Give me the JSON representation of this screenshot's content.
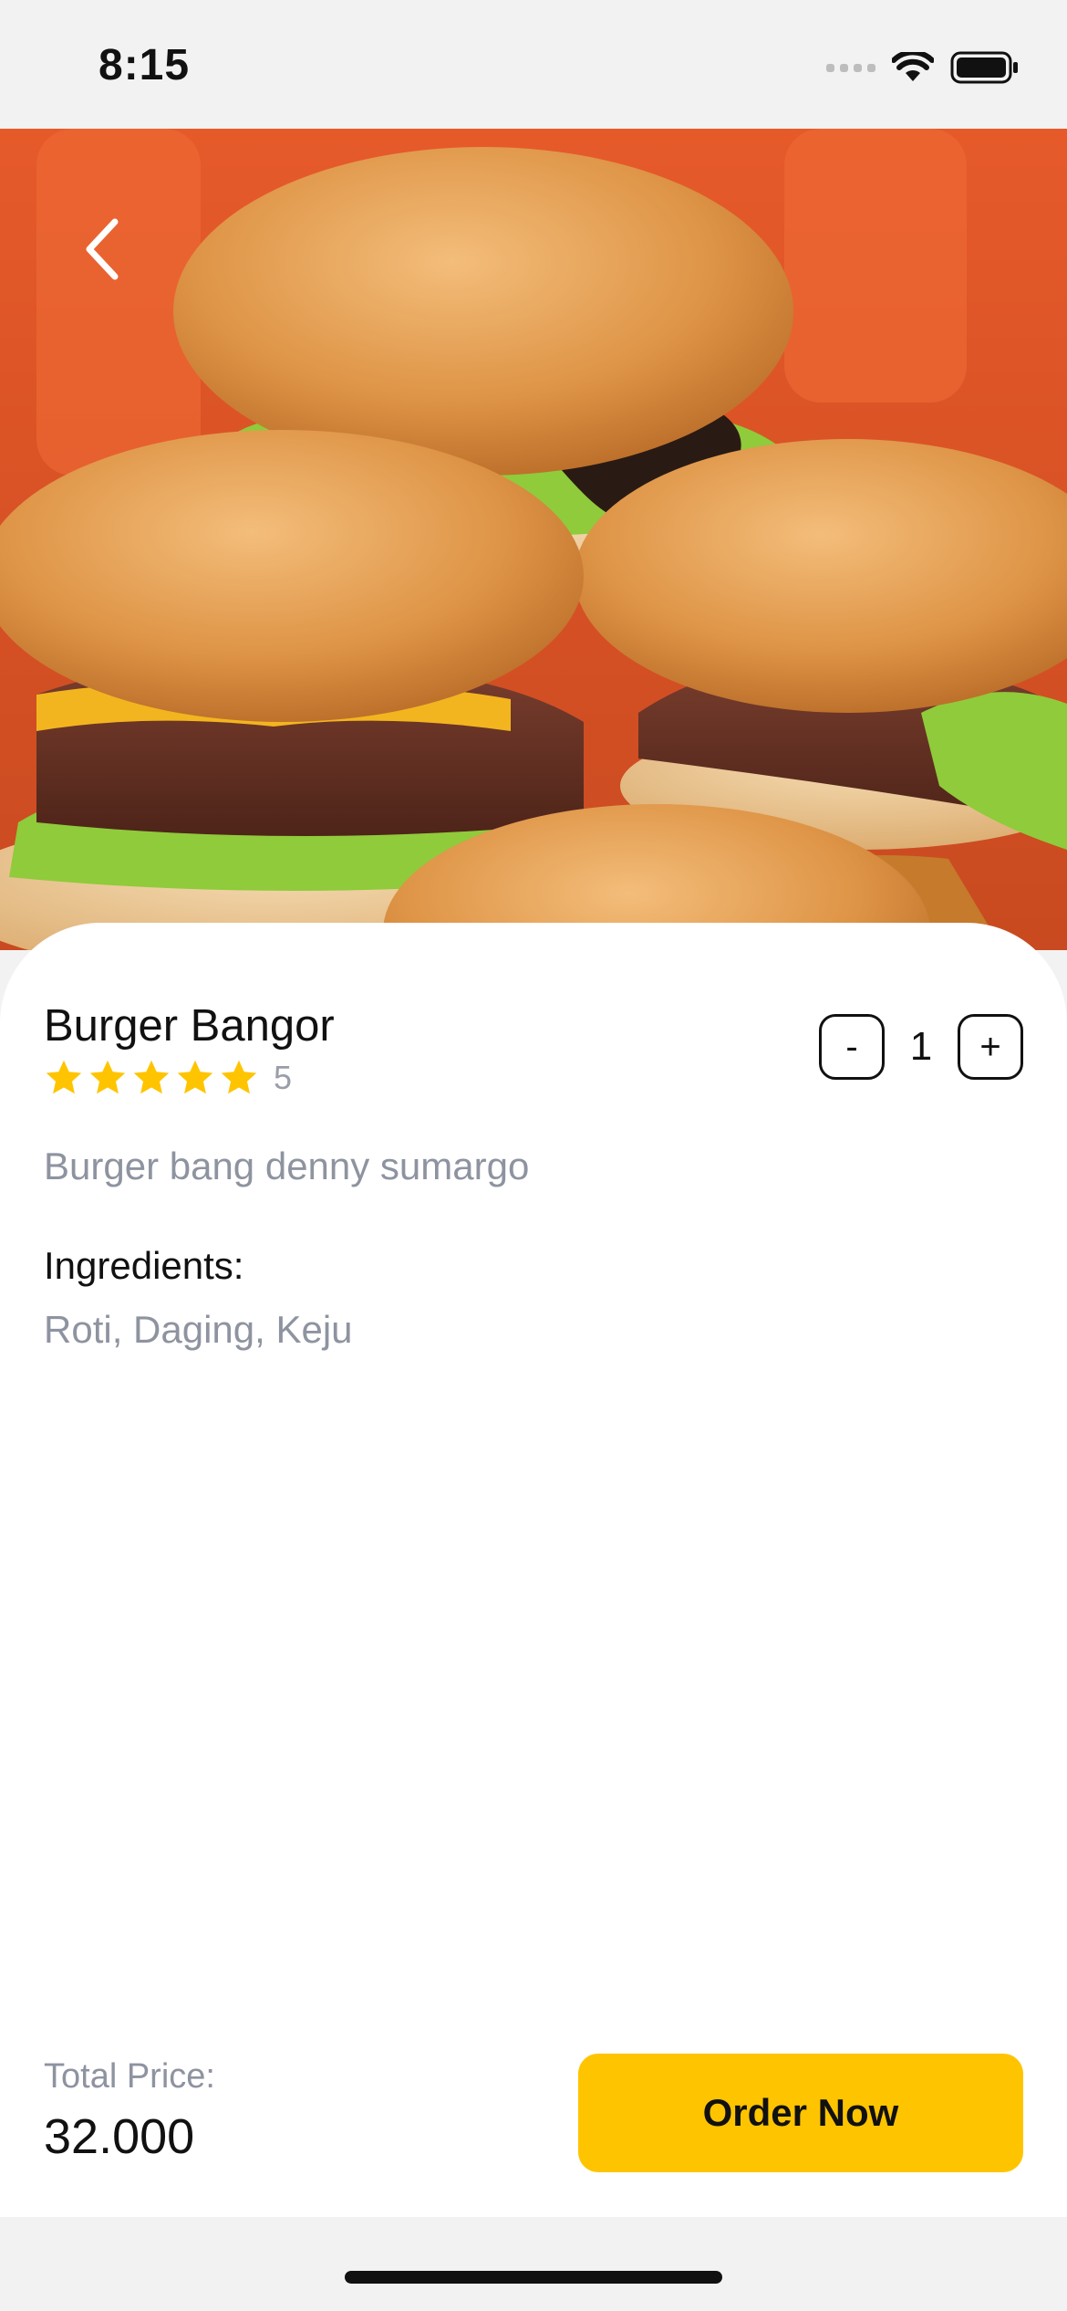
{
  "status_bar": {
    "time": "8:15"
  },
  "product": {
    "name": "Burger Bangor",
    "rating_stars": 5,
    "rating_value": "5",
    "description": "Burger bang denny sumargo",
    "ingredients_label": "Ingredients:",
    "ingredients": "Roti, Daging, Keju"
  },
  "quantity": {
    "minus_label": "-",
    "value": "1",
    "plus_label": "+"
  },
  "footer": {
    "total_label": "Total Price:",
    "total_value": "32.000",
    "order_button": "Order Now"
  },
  "colors": {
    "accent": "#FFC400",
    "star": "#FFC400",
    "muted_text": "#8E93A0"
  },
  "icons": {
    "back": "chevron-left-icon",
    "star": "star-icon",
    "wifi": "wifi-icon",
    "battery": "battery-icon"
  }
}
